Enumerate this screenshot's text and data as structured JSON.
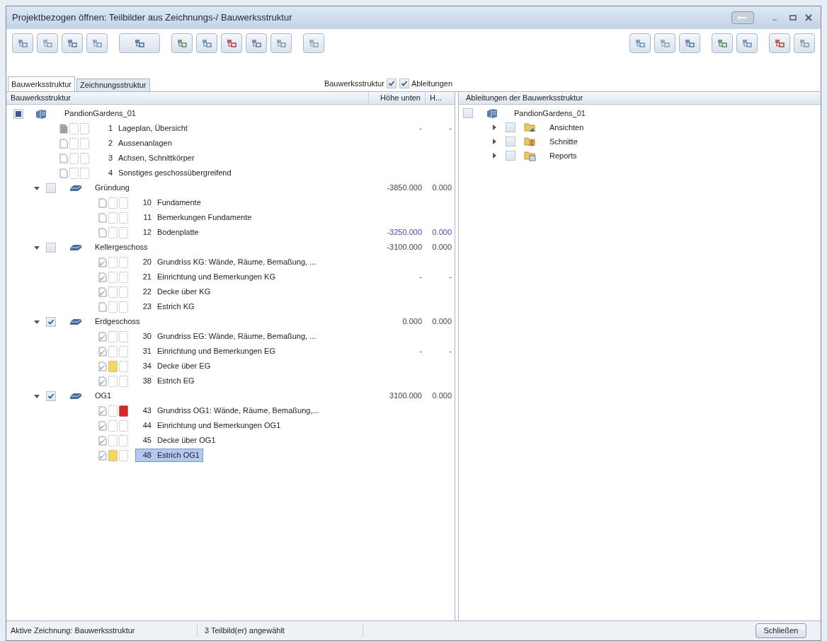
{
  "window": {
    "title": "Projektbezogen öffnen: Teilbilder aus Zeichnungs-/ Bauwerksstruktur"
  },
  "tabs": [
    {
      "label": "Bauwerksstruktur",
      "selected": true
    },
    {
      "label": "Zeichnungsstruktur",
      "selected": false
    }
  ],
  "options": [
    {
      "label": "Bauwerksstruktur",
      "checked": true,
      "label_first": true
    },
    {
      "label": "Ableitungen",
      "checked": true,
      "label_first": false
    }
  ],
  "left_columns": [
    "Bauwerksstruktur",
    "Höhe unten",
    "H..."
  ],
  "tree": {
    "label": "PandionGardens_01",
    "partial": true,
    "children": [
      {
        "kind": "layout",
        "number": "1",
        "label": "Lageplan, Übersicht",
        "values": [
          "-",
          "-"
        ],
        "active": false,
        "locked": false,
        "selected": false
      },
      {
        "kind": "page",
        "number": "2",
        "label": "Aussenanlagen",
        "active": false,
        "locked": false,
        "selected": false
      },
      {
        "kind": "page",
        "number": "3",
        "label": "Achsen, Schnittkörper",
        "active": false,
        "locked": false,
        "selected": false
      },
      {
        "kind": "page",
        "number": "4",
        "label": "Sonstiges geschossübergreifend",
        "active": false,
        "locked": false,
        "selected": false
      },
      {
        "kind": "group",
        "label": "Gründung",
        "checked": false,
        "expanded": true,
        "values": [
          "-3850.000",
          "0.000"
        ],
        "children": [
          {
            "kind": "page",
            "number": "10",
            "label": "Fundamente",
            "active": false,
            "locked": false,
            "selected": false
          },
          {
            "kind": "page",
            "number": "11",
            "label": "Bemerkungen Fundamente",
            "active": false,
            "locked": false,
            "selected": false
          },
          {
            "kind": "page",
            "number": "12",
            "label": "Bodenplatte",
            "values": [
              "-3250.000",
              "0.000"
            ],
            "modified": true,
            "active": false,
            "locked": false,
            "selected": false
          }
        ]
      },
      {
        "kind": "group",
        "label": "Kellergeschoss",
        "checked": false,
        "expanded": true,
        "values": [
          "-3100.000",
          "0.000"
        ],
        "children": [
          {
            "kind": "plan",
            "number": "20",
            "label": "Grundriss KG: Wände, Räume, Bemaßung, ...",
            "active": false,
            "locked": false,
            "selected": false
          },
          {
            "kind": "plan",
            "number": "21",
            "label": "Einrichtung und Bemerkungen KG",
            "values": [
              "-",
              "-"
            ],
            "active": false,
            "locked": false,
            "selected": false
          },
          {
            "kind": "plan",
            "number": "22",
            "label": "Decke über KG",
            "active": false,
            "locked": false,
            "selected": false
          },
          {
            "kind": "page",
            "number": "23",
            "label": "Estrich KG",
            "active": false,
            "locked": false,
            "selected": false
          }
        ]
      },
      {
        "kind": "group",
        "label": "Erdgeschoss",
        "checked": true,
        "expanded": true,
        "values": [
          "0.000",
          "0.000"
        ],
        "children": [
          {
            "kind": "plan",
            "number": "30",
            "label": "Grundriss EG: Wände, Räume, Bemaßung, ...",
            "active": false,
            "locked": false,
            "selected": false
          },
          {
            "kind": "plan",
            "number": "31",
            "label": "Einrichtung und Bemerkungen EG",
            "values": [
              "-",
              "-"
            ],
            "active": false,
            "locked": false,
            "selected": false
          },
          {
            "kind": "plan",
            "number": "34",
            "label": "Decke über EG",
            "active": true,
            "locked": false,
            "selected": false
          },
          {
            "kind": "plan",
            "number": "38",
            "label": "Estrich EG",
            "active": false,
            "locked": false,
            "selected": false
          }
        ]
      },
      {
        "kind": "group",
        "label": "OG1",
        "checked": true,
        "expanded": true,
        "values": [
          "3100.000",
          "0.000"
        ],
        "children": [
          {
            "kind": "plan",
            "number": "43",
            "label": "Grundriss OG1: Wände, Räume, Bemaßung,...",
            "active": false,
            "locked": true,
            "selected": false
          },
          {
            "kind": "plan",
            "number": "44",
            "label": "Einrichtung und Bemerkungen OG1",
            "active": false,
            "locked": false,
            "selected": false
          },
          {
            "kind": "plan",
            "number": "45",
            "label": "Decke über OG1",
            "active": false,
            "locked": false,
            "selected": false
          },
          {
            "kind": "plan",
            "number": "48",
            "label": "Estrich OG1",
            "active": true,
            "locked": false,
            "selected": true
          }
        ]
      }
    ]
  },
  "right_column": "Ableitungen der Bauwerksstruktur",
  "derivations": {
    "label": "PandionGardens_01",
    "checked": false,
    "children": [
      {
        "label": "Ansichten",
        "kind": "views",
        "checked": false,
        "expanded": false
      },
      {
        "label": "Schnitte",
        "kind": "sections",
        "checked": false,
        "expanded": false
      },
      {
        "label": "Reports",
        "kind": "reports",
        "checked": false,
        "expanded": false
      }
    ]
  },
  "status_bar": [
    "Aktive Zeichnung: Bauwerksstruktur",
    "3 Teilbild(er) angewählt"
  ],
  "close_button": "Schließen"
}
